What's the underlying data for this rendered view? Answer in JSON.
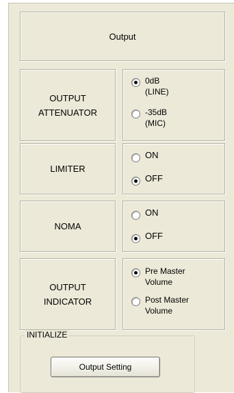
{
  "header": {
    "title": "Output"
  },
  "rows": [
    {
      "label_line1": "OUTPUT",
      "label_line2": "ATTENUATOR",
      "options": [
        "0dB\n(LINE)",
        "-35dB\n(MIC)"
      ],
      "selected": 0
    },
    {
      "label_line1": "LIMITER",
      "options": [
        "ON",
        "OFF"
      ],
      "selected": 1
    },
    {
      "label_line1": "NOMA",
      "options": [
        "ON",
        "OFF"
      ],
      "selected": 1
    },
    {
      "label_line1": "OUTPUT",
      "label_line2": "INDICATOR",
      "options": [
        "Pre Master\nVolume",
        "Post Master\nVolume"
      ],
      "selected": 0
    }
  ],
  "initialize": {
    "group_label": "INITIALIZE",
    "button_label": "Output Setting"
  }
}
